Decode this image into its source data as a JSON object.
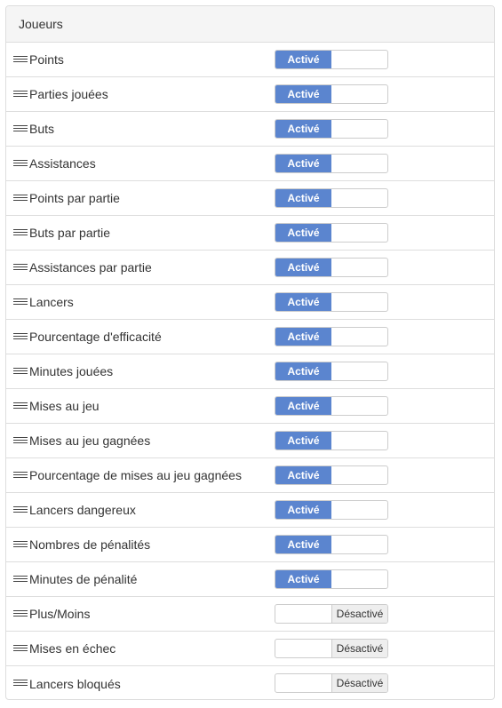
{
  "panel": {
    "title": "Joueurs"
  },
  "toggle_labels": {
    "on": "Activé",
    "off": "Désactivé"
  },
  "colors": {
    "active": "#5b85cf",
    "inactive": "#eeeeee"
  },
  "rows": [
    {
      "label": "Points",
      "active": true
    },
    {
      "label": "Parties jouées",
      "active": true
    },
    {
      "label": "Buts",
      "active": true
    },
    {
      "label": "Assistances",
      "active": true
    },
    {
      "label": "Points par partie",
      "active": true
    },
    {
      "label": "Buts par partie",
      "active": true
    },
    {
      "label": "Assistances par partie",
      "active": true
    },
    {
      "label": "Lancers",
      "active": true
    },
    {
      "label": "Pourcentage d'efficacité",
      "active": true
    },
    {
      "label": "Minutes jouées",
      "active": true
    },
    {
      "label": "Mises au jeu",
      "active": true
    },
    {
      "label": "Mises au jeu gagnées",
      "active": true
    },
    {
      "label": "Pourcentage de mises au jeu gagnées",
      "active": true
    },
    {
      "label": "Lancers dangereux",
      "active": true
    },
    {
      "label": "Nombres de pénalités",
      "active": true
    },
    {
      "label": "Minutes de pénalité",
      "active": true
    },
    {
      "label": "Plus/Moins",
      "active": false
    },
    {
      "label": "Mises en échec",
      "active": false
    },
    {
      "label": "Lancers bloqués",
      "active": false
    }
  ]
}
